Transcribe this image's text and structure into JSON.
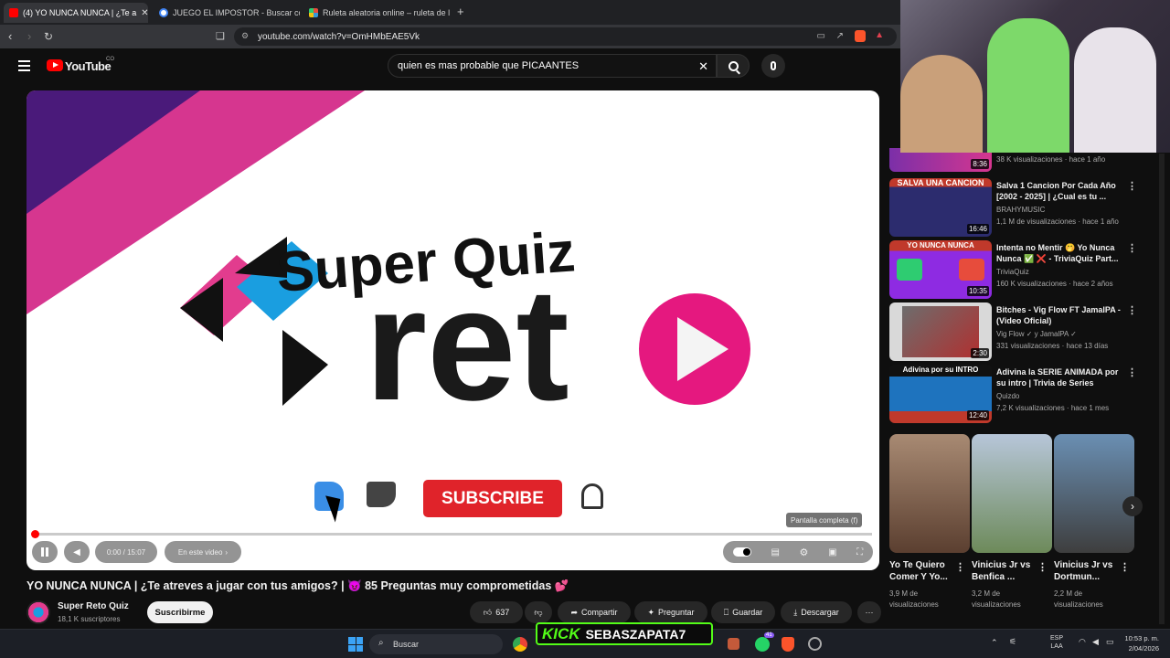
{
  "browser": {
    "tabs": [
      {
        "label": "(4) YO NUNCA NUNCA | ¿Te a",
        "active": true
      },
      {
        "label": "JUEGO EL IMPOSTOR - Buscar con G",
        "active": false
      },
      {
        "label": "Ruleta aleatoria online – ruleta de la",
        "active": false
      }
    ],
    "new_tab": "+",
    "url": "youtube.com/watch?v=OmHMbEAE5Vk"
  },
  "youtube": {
    "logo_text": "YouTube",
    "country": "CO",
    "search_value": "quien es mas probable que PICAANTES"
  },
  "player": {
    "title_word1": "Super Quiz",
    "title_word2": "ret",
    "subscribe_label": "SUBSCRIBE",
    "time": "0:00 / 15:07",
    "chapter": "En este video",
    "fullscreen_tooltip": "Pantalla completa (f)",
    "progress": 0.0
  },
  "video": {
    "title": "YO NUNCA NUNCA | ¿Te atreves a jugar con tus amigos? | 😈 85 Preguntas muy comprometidas 💕",
    "channel": "Super Reto Quiz",
    "subscribers": "18,1 K suscriptores",
    "subscribe_btn": "Suscribirme",
    "likes": "637",
    "share": "Compartir",
    "ask": "Preguntar",
    "save": "Guardar",
    "download": "Descargar",
    "more": "···"
  },
  "sidebar": {
    "partial_meta": "38 K visualizaciones · hace 1 año",
    "partial_dur": "8:36",
    "videos": [
      {
        "thumb_text": "SALVA UNA CANCION",
        "duration": "16:46",
        "title": "Salva 1 Cancion Por Cada Año [2002 - 2025] | ¿Cual es tu ...",
        "channel": "BRAHYMUSIC",
        "meta": "1,1 M de visualizaciones · hace 1 año",
        "color": "#c0392b"
      },
      {
        "thumb_text": "YO NUNCA NUNCA",
        "duration": "10:35",
        "title": "Intenta no Mentir 🤭 Yo Nunca Nunca ✅ ❌ - TriviaQuiz Part...",
        "channel": "TriviaQuiz",
        "meta": "160 K visualizaciones · hace 2 años",
        "color": "#8e2be2"
      },
      {
        "thumb_text": "",
        "duration": "2:30",
        "title": "Bitches - Vig Flow FT JamalPA - (Video Oficial)",
        "channel": "Vig Flow ✓ y JamalPA ✓",
        "meta": "331 visualizaciones · hace 13 días",
        "color": "#6d6d6d"
      },
      {
        "thumb_text": "Adivina por su INTRO",
        "duration": "12:40",
        "title": "Adivina la SERIE ANIMADA por su intro | Trivia de Series",
        "channel": "Quizdo",
        "meta": "7,2 K visualizaciones · hace 1 mes",
        "color": "#1e73be"
      }
    ],
    "shorts": [
      {
        "title": "Yo Te Quiero Comer Y Yo...",
        "meta": "3,9 M de visualizaciones"
      },
      {
        "title": "Vinicius Jr vs Benfica ...",
        "meta": "3,2 M de visualizaciones"
      },
      {
        "title": "Vinicius Jr vs Dortmun...",
        "meta": "2,2 M de visualizaciones"
      }
    ]
  },
  "overlay": {
    "kick_label": "KICK",
    "kick_user": "SEBASZAPATA7"
  },
  "taskbar": {
    "search": "Buscar",
    "lang": "ESP",
    "region": "LAA",
    "time": "10:53 p. m.",
    "date": "2/04/2026",
    "whatsapp_badge": "41"
  }
}
